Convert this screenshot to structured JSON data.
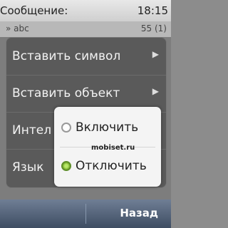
{
  "status": {
    "title": "Сообщение:",
    "time": "18:15"
  },
  "message_row": {
    "left": "» abc",
    "right": "55 (1)"
  },
  "menu": {
    "items": [
      {
        "label": "Вставить символ"
      },
      {
        "label": "Вставить объект"
      },
      {
        "label": "Интел"
      },
      {
        "label": "Язык"
      }
    ]
  },
  "submenu": {
    "options": [
      {
        "label": "Включить",
        "selected": false
      },
      {
        "label": "Отключить",
        "selected": true
      }
    ],
    "watermark": "mobiset.ru"
  },
  "softkeys": {
    "right": "Назад"
  },
  "colors": {
    "softbar": "#4a5a71",
    "radio_on": "#78ad2b"
  }
}
